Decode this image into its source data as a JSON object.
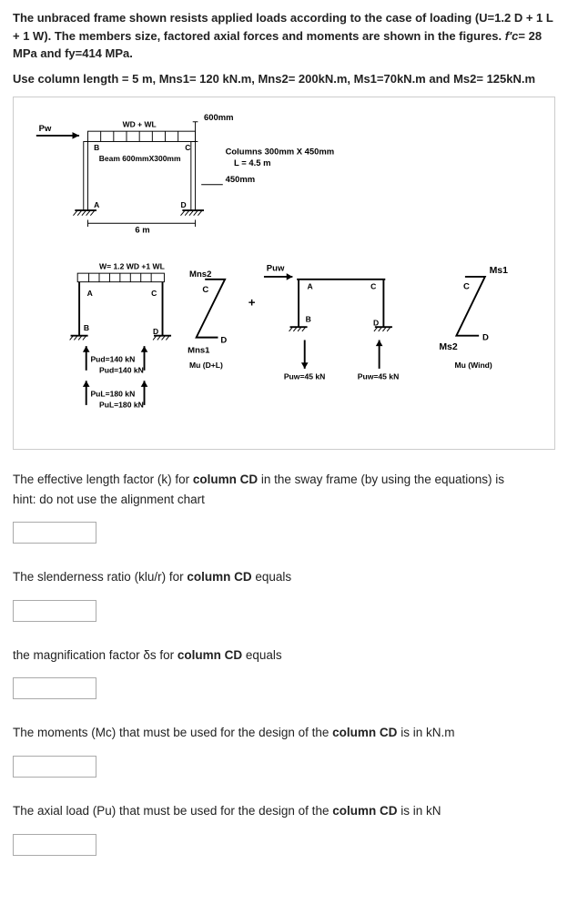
{
  "intro": {
    "p1a": "The unbraced frame shown resists applied loads according to the case of loading (U=1.2 D + 1 L + 1 W). The members size, factored axial forces and moments are shown in the figures.  ",
    "p1b_fc": "f'c",
    "p1c": "= 28 MPa and fy=414 MPa.",
    "p2": "Use column length = 5 m, Mns1= 120 kN.m, Mns2= 200kN.m, Ms1=70kN.m and Ms2= 125kN.m"
  },
  "fig1": {
    "dim_top": "600mm",
    "load_top": "WD + WL",
    "Pw": "Pw",
    "B": "B",
    "C": "C",
    "beam": "Beam 600mmX300mm",
    "columns": "Columns 300mm X 450mm",
    "L": "L = 4.5 m",
    "col_dim": "450mm",
    "A": "A",
    "D": "D",
    "span": "6 m"
  },
  "fig2": {
    "W": "W= 1.2 WD +1 WL",
    "A": "A",
    "C": "C",
    "B": "B",
    "D": "D",
    "Mns2": "Mns2",
    "Mns1": "Mns1",
    "MuDL": "Mu (D+L)",
    "Pud_top": "Pud=140 kN",
    "Pud_bot": "Pud=140 kN",
    "Pul_top": "PuL=180 kN",
    "Pul_bot": "PuL=180 kN"
  },
  "fig3": {
    "Puw": "Puw",
    "A": "A",
    "C": "C",
    "B": "B",
    "D": "D",
    "plus": "+",
    "Puw_left": "Puw=45 kN",
    "Puw_right": "Puw=45 kN"
  },
  "fig4": {
    "Ms1": "Ms1",
    "Ms2": "Ms2",
    "C": "C",
    "D": "D",
    "MuWind": "Mu (Wind)"
  },
  "questions": {
    "q1a": "The effective length factor (k) for ",
    "q1b": "column CD",
    "q1c": " in the sway frame (by using the equations) is",
    "q1_hint": "hint: do not use the alignment chart",
    "q2a": "The slenderness ratio (klu/r) for ",
    "q2b": "column CD",
    "q2c": " equals",
    "q3a": "the magnification factor  δs for ",
    "q3b": "column CD",
    "q3c": " equals",
    "q4a": "The moments (Mc) that must be used for the design of the ",
    "q4b": "column CD",
    "q4c": "  is in kN.m",
    "q5a": "The axial load (Pu) that must be used for the design of the ",
    "q5b": "column CD",
    "q5c": "  is in kN"
  }
}
